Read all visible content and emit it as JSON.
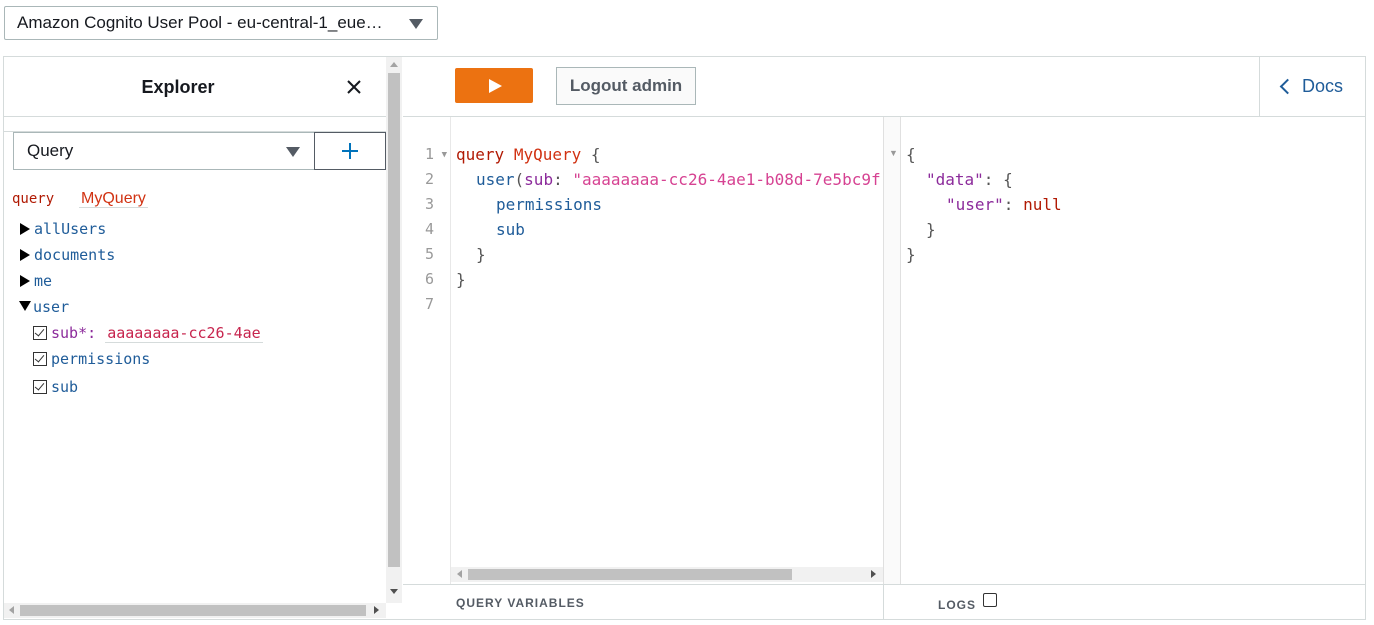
{
  "auth": {
    "selected": "Amazon Cognito User Pool - eu-central-1_eue…"
  },
  "explorer": {
    "title": "Explorer",
    "operation_type": "Query",
    "operation_keyword": "query",
    "operation_name": "MyQuery",
    "fields": [
      {
        "name": "allUsers",
        "expanded": false
      },
      {
        "name": "documents",
        "expanded": false
      },
      {
        "name": "me",
        "expanded": false
      },
      {
        "name": "user",
        "expanded": true
      }
    ],
    "user_children": {
      "arg_label": "sub*:",
      "arg_value": "aaaaaaaa-cc26-4ae",
      "field1": "permissions",
      "field2": "sub"
    }
  },
  "toolbar": {
    "logout_label": "Logout admin",
    "docs_label": "Docs"
  },
  "editor": {
    "line_numbers": [
      "1",
      "2",
      "3",
      "4",
      "5",
      "6",
      "7"
    ],
    "line1": {
      "kw": "query",
      "name": "MyQuery",
      "brace": "{"
    },
    "line2": {
      "field": "user",
      "open": "(",
      "arg": "sub",
      "colon": ": ",
      "value": "\"aaaaaaaa-cc26-4ae1-b08d-7e5bc9f"
    },
    "line3": "permissions",
    "line4": "sub",
    "line5": "}",
    "line6": "}"
  },
  "result": {
    "open": "{",
    "data_key": "\"data\"",
    "data_open": ": {",
    "user_key": "\"user\"",
    "user_sep": ": ",
    "user_val": "null",
    "inner_close": "}",
    "outer_close": "}"
  },
  "bottom": {
    "query_variables_label": "QUERY VARIABLES",
    "logs_label": "LOGS"
  },
  "colors": {
    "run_button": "#ec7211",
    "link": "#1f5c99",
    "keyword": "#b11a04"
  }
}
